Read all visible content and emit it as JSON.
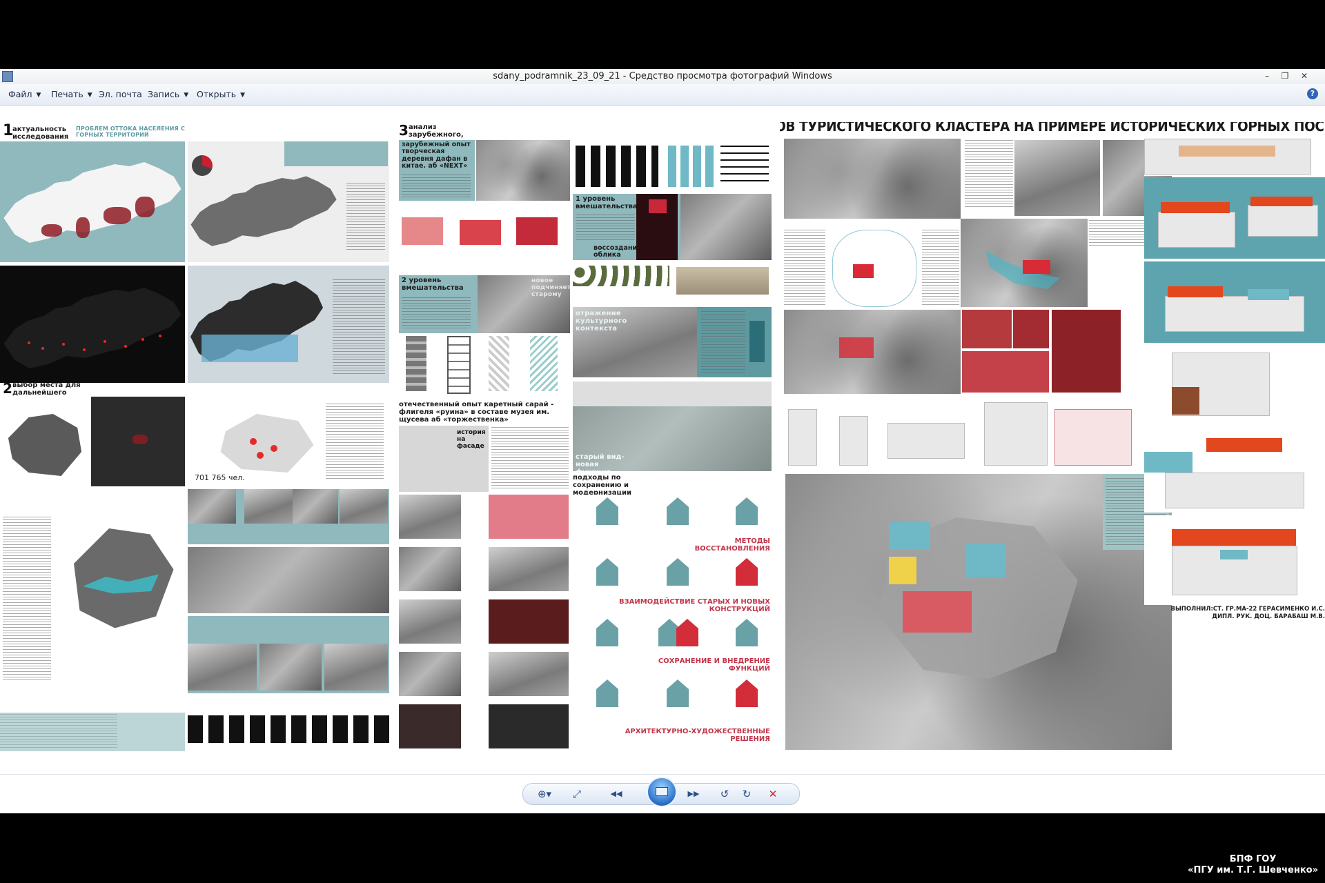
{
  "window": {
    "title": "sdany_podramnik_23_09_21 - Средство просмотра фотографий Windows",
    "controls": {
      "minimize": "–",
      "restore": "❐",
      "close": "✕"
    }
  },
  "menu": [
    {
      "label": "Файл",
      "has_dropdown": true
    },
    {
      "label": "Печать",
      "has_dropdown": true
    },
    {
      "label": "Эл. почта",
      "has_dropdown": false
    },
    {
      "label": "Запись",
      "has_dropdown": true
    },
    {
      "label": "Открыть",
      "has_dropdown": true
    }
  ],
  "help": "?",
  "poster": {
    "main_title": "РЕВИТАЛИЗАЦИЯ ОБЪЕКТОВ ТУРИСТИЧЕСКОГО КЛАСТЕРА НА ПРИМЕРЕ ИСТОРИЧЕСКИХ ГОРНЫХ ПОСЕЛЕНИЙ СЕВЕРНОЙ ОСЕТИИ",
    "s1_num": "1",
    "s1_title": "актуальность исследования",
    "s1_sub": "ПРОБЛЕМ ОТТОКА НАСЕЛЕНИЯ С ГОРНЫХ ТЕРРИТОРИЙ",
    "s2_num": "2",
    "s2_title": "выбор места для дальнейшего исследования",
    "s3_num": "3",
    "s3_title": "анализ зарубежного, отечественного опыта",
    "foreign_exp": "зарубежный опыт творческая деревня дафан в китае. аб «NEXT»",
    "level1": "1 уровень вмешательства",
    "level2": "2 уровень вмешательства",
    "vosstanovlenie": "воссоздание облика",
    "new_old": "новое подчиняется старому",
    "cultural": "отражение культурного контекста",
    "domestic_exp": "отечественный опыт каретный сарай - флигеля «руина» в составе музея им. щусева аб «торжественка»",
    "history": "история на фасаде",
    "old_new_func": "старый вид- новая функция",
    "approaches": "подходы по сохранению и модернизации",
    "methods": "МЕТОДЫ ВОССТАНОВЛЕНИЯ",
    "interaction": "ВЗАИМОДЕЙСТВИЕ СТАРЫХ И НОВЫХ КОНСТРУКЦИЙ",
    "preservation": "СОХРАНЕНИЕ И ВНЕДРЕНИЕ ФУНКЦИЙ",
    "art_solutions": "АРХИТЕКТУРНО-ХУДОЖЕСТВЕННЫЕ РЕШЕНИЯ",
    "stat_number": "701 765 чел.",
    "author_line1": "ВЫПОЛНИЛ:СТ. ГР.МА-22 ГЕРАСИМЕНКО И.С.",
    "author_line2": "ДИПЛ. РУК. ДОЦ. БАРАБАШ М.В."
  },
  "navbar": {
    "zoom": "⊕▾",
    "fit": "⤢",
    "prev": "◀◀",
    "next": "▶▶",
    "rotate_ccw": "↺",
    "rotate_cw": "↻",
    "delete": "✕"
  },
  "watermark": {
    "line1": "БПФ ГОУ",
    "line2": "«ПГУ им. Т.Г. Шевченко»"
  }
}
